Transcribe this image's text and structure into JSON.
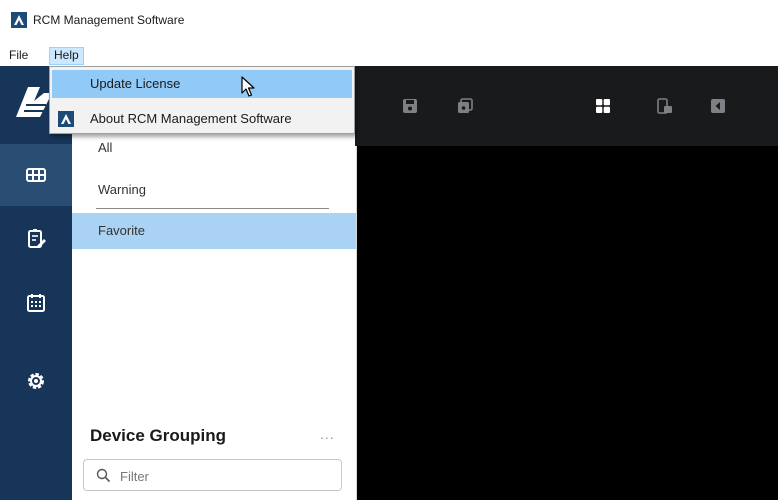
{
  "window": {
    "title": "RCM Management Software"
  },
  "menubar": {
    "file": "File",
    "help": "Help"
  },
  "help_menu": {
    "items": [
      {
        "label": "Update License",
        "icon": "none",
        "hovered": true
      },
      {
        "label": "About RCM Management Software",
        "icon": "app-logo-icon",
        "hovered": false
      }
    ]
  },
  "rail": {
    "items": [
      {
        "icon": "grid-view-icon",
        "active": true
      },
      {
        "icon": "report-edit-icon",
        "active": false
      },
      {
        "icon": "calendar-icon",
        "active": false
      },
      {
        "icon": "gear-icon",
        "active": false
      }
    ]
  },
  "panel": {
    "items": [
      {
        "label": "All",
        "selected": false
      },
      {
        "label": "Warning",
        "selected": false
      },
      {
        "label": "Favorite",
        "selected": true
      }
    ],
    "group_title": "Device Grouping",
    "more_label": "...",
    "filter": {
      "placeholder": "Filter",
      "value": ""
    }
  },
  "video_toolbar": {
    "icons": [
      "save-icon",
      "save-all-icon",
      "layout-grid-icon",
      "split-icon",
      "previous-icon"
    ]
  },
  "colors": {
    "rail": "#173558",
    "rail_active": "#2a4d73",
    "selected_row": "#a9d2f5",
    "menu_hover": "#91c9f7",
    "video_bg": "#000000",
    "toolbar_bg": "#181a1c"
  }
}
